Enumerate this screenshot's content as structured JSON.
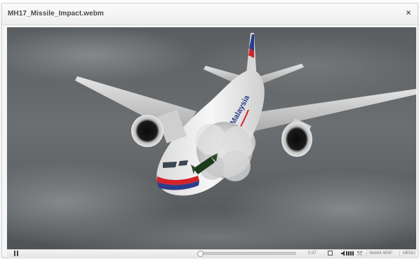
{
  "window": {
    "title": "MH17_Missile_Impact.webm",
    "close_symbol": "×"
  },
  "player": {
    "time": "0:37",
    "quality": "WebM 480P",
    "menu": "MENU",
    "progress": 0.01,
    "fullscreen_symbol": "⤧"
  },
  "video": {
    "livery_text": "Malaysia",
    "scene": "Boeing 777 in flight with missile fragment impact near the cockpit"
  },
  "colors": {
    "titlebar": "#f0f0f0",
    "sky": "#5f6366",
    "fuselage": "#f2f2f2",
    "stripe_red": "#d2232a",
    "stripe_blue": "#2a3e8c"
  }
}
